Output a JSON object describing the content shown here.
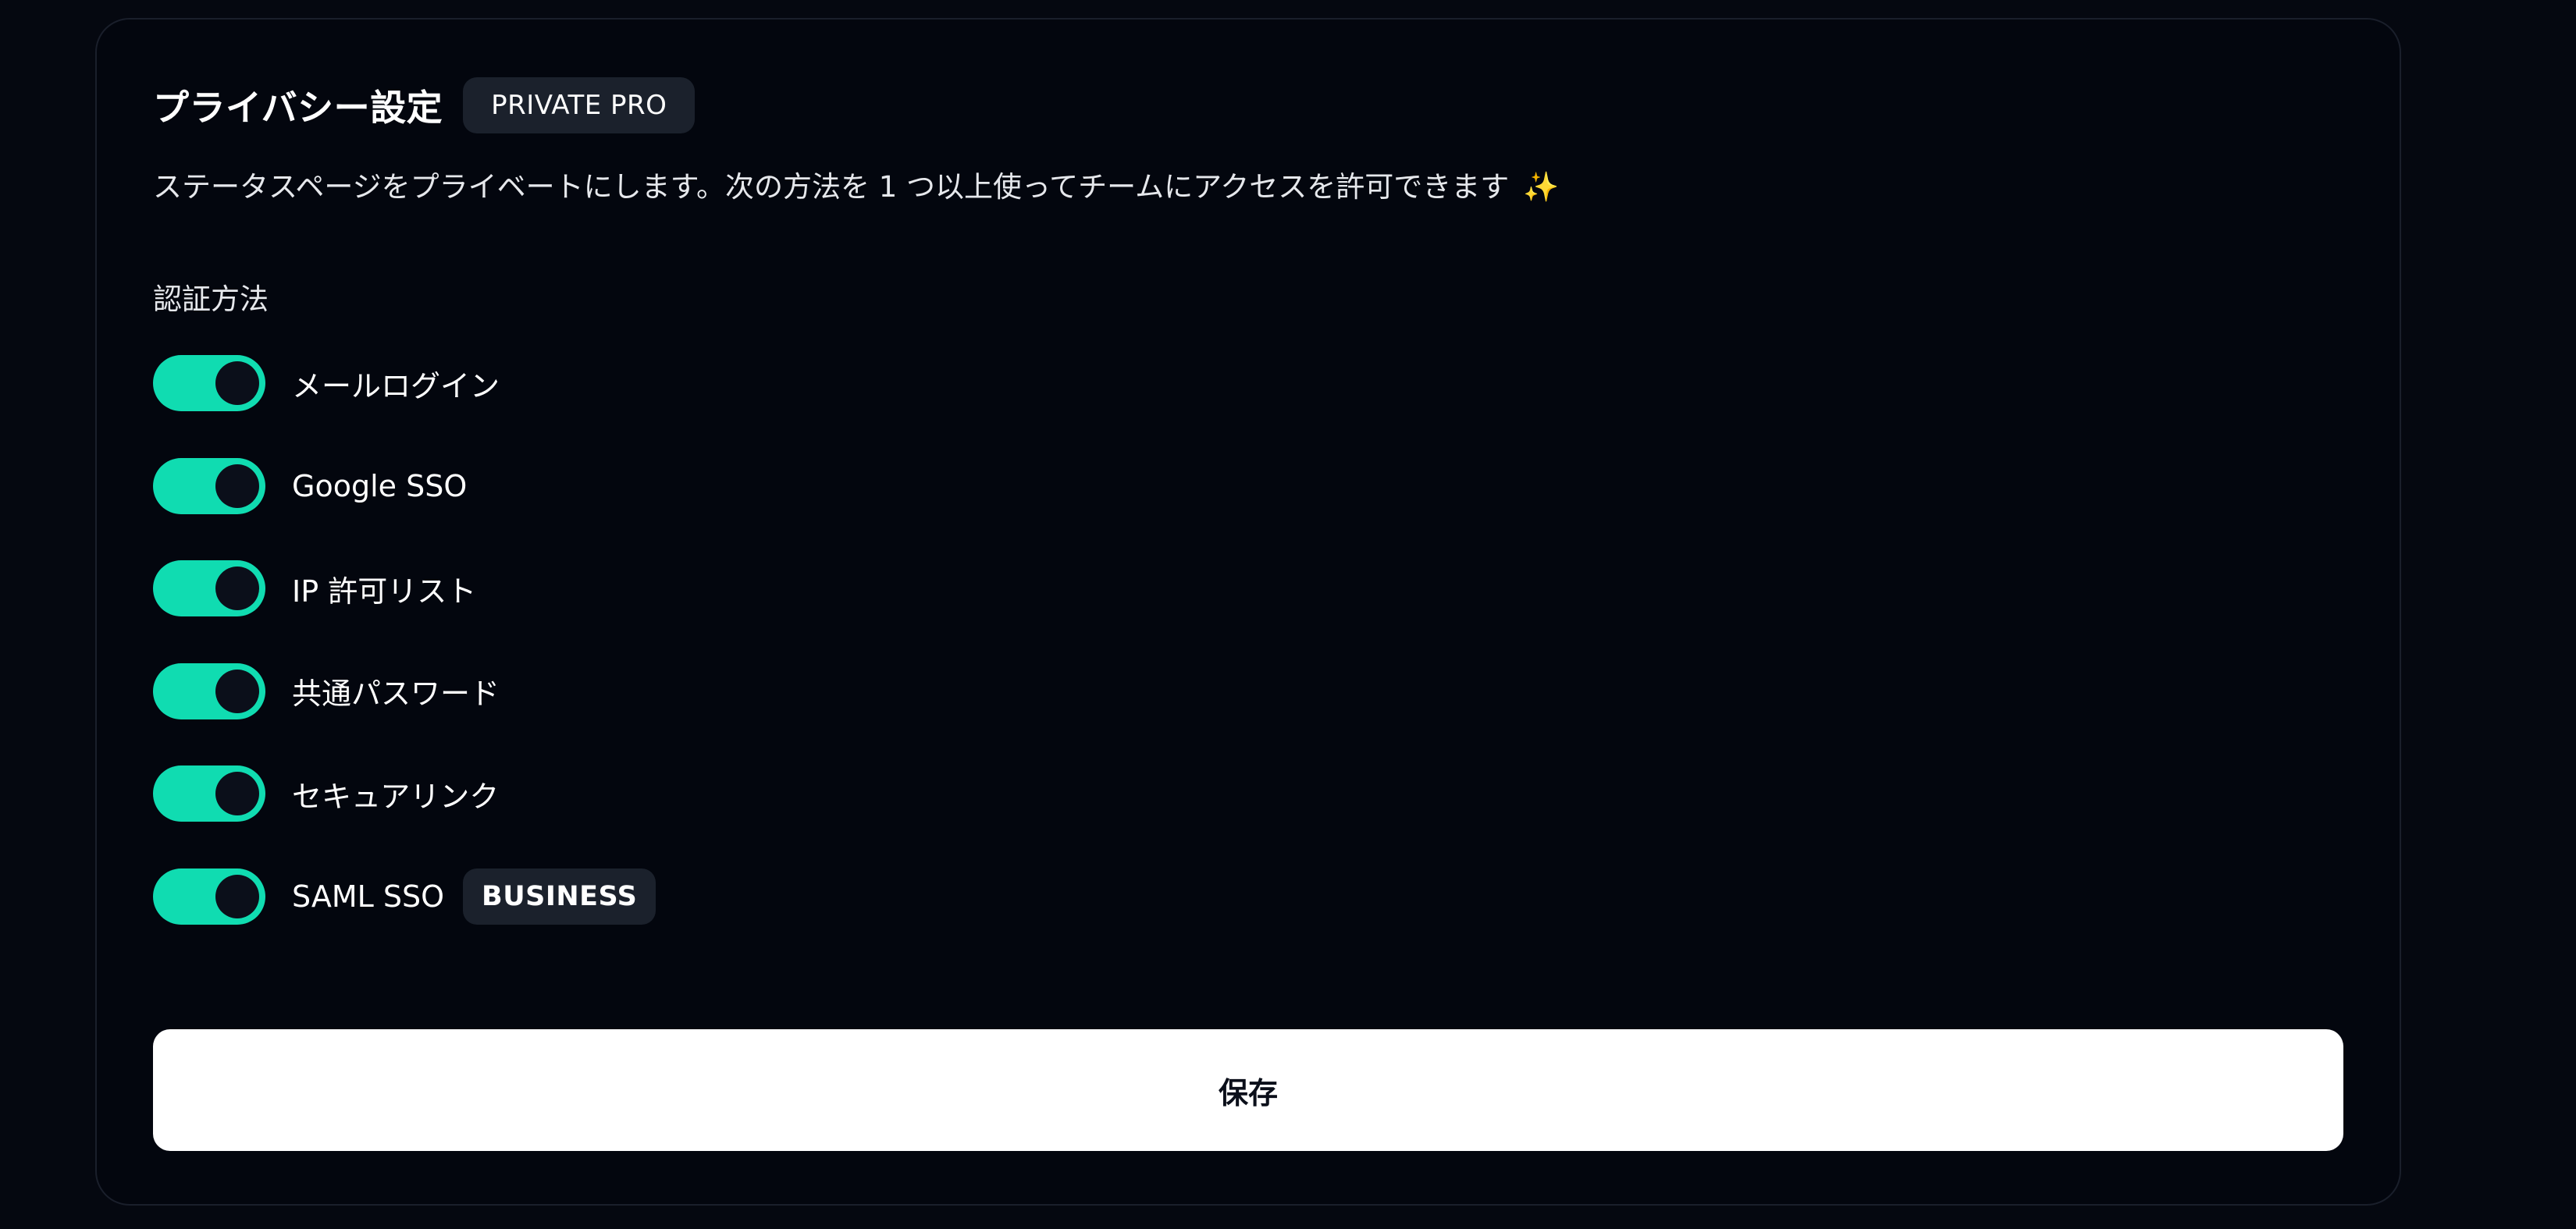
{
  "privacy": {
    "title": "プライバシー設定",
    "plan_badge": "PRIVATE PRO",
    "description": "ステータスページをプライベートにします。次の方法を 1 つ以上使ってチームにアクセスを許可できます",
    "sparkle": "✨",
    "section_label": "認証方法",
    "accent_color": "#10dcb1",
    "methods": [
      {
        "label": "メールログイン",
        "enabled": true
      },
      {
        "label": "Google SSO",
        "enabled": true
      },
      {
        "label": "IP 許可リスト",
        "enabled": true
      },
      {
        "label": "共通パスワード",
        "enabled": true
      },
      {
        "label": "セキュアリンク",
        "enabled": true
      },
      {
        "label": "SAML SSO",
        "enabled": true,
        "badge": "BUSINESS"
      }
    ],
    "save_label": "保存"
  }
}
